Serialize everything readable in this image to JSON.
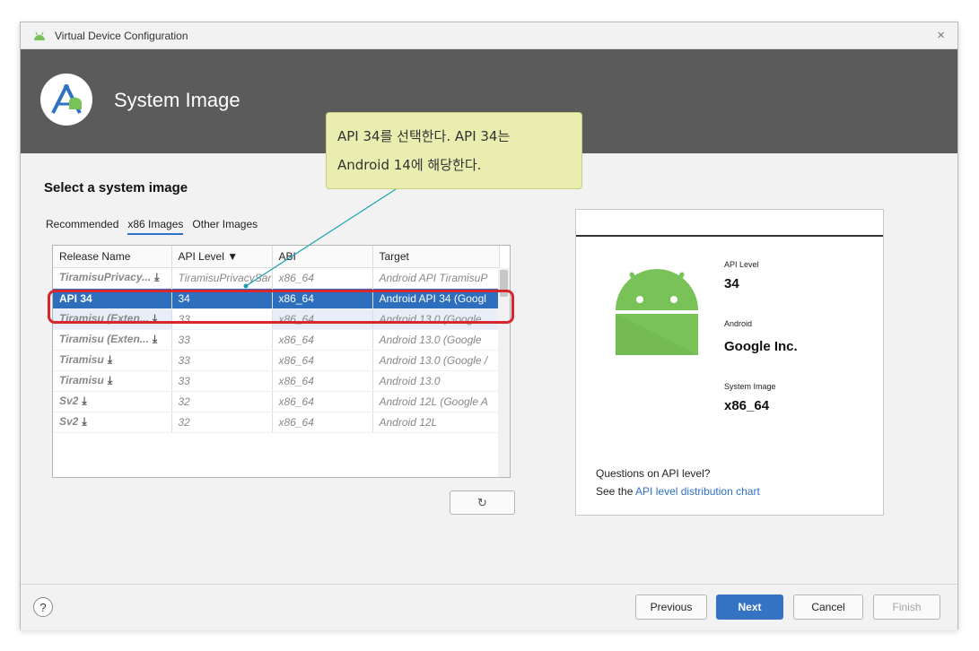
{
  "window": {
    "title": "Virtual Device Configuration",
    "close_glyph": "×"
  },
  "header": {
    "title": "System Image"
  },
  "callout": {
    "line1": "API 34를 선택한다. API 34는",
    "line2": "Android 14에 해당한다."
  },
  "section_title": "Select a system image",
  "tabs": [
    {
      "label": "Recommended"
    },
    {
      "label": "x86 Images",
      "active": true
    },
    {
      "label": "Other Images"
    }
  ],
  "table": {
    "columns": [
      "Release Name",
      "API Level ▼",
      "ABI",
      "Target"
    ],
    "rows": [
      {
        "name": "TiramisuPrivacy...",
        "download": true,
        "api": "TiramisuPrivacySar",
        "abi": "x86_64",
        "target": "Android API TiramisuP"
      },
      {
        "name": "API 34",
        "download": false,
        "api": "34",
        "abi": "x86_64",
        "target": "Android API 34 (Googl",
        "selected": true
      },
      {
        "name": "Tiramisu (Exten...",
        "download": true,
        "api": "33",
        "abi": "x86_64",
        "target": "Android 13.0 (Google ",
        "light": true
      },
      {
        "name": "Tiramisu (Exten...",
        "download": true,
        "api": "33",
        "abi": "x86_64",
        "target": "Android 13.0 (Google "
      },
      {
        "name": "Tiramisu",
        "download": true,
        "api": "33",
        "abi": "x86_64",
        "target": "Android 13.0 (Google /"
      },
      {
        "name": "Tiramisu",
        "download": true,
        "api": "33",
        "abi": "x86_64",
        "target": "Android 13.0"
      },
      {
        "name": "Sv2",
        "download": true,
        "api": "32",
        "abi": "x86_64",
        "target": "Android 12L (Google A"
      },
      {
        "name": "Sv2",
        "download": true,
        "api": "32",
        "abi": "x86_64",
        "target": "Android 12L"
      }
    ]
  },
  "refresh_glyph": "↻",
  "details": {
    "api_level_label": "API Level",
    "api_level_value": "34",
    "vendor_label": "Android",
    "vendor_value": "Google Inc.",
    "system_image_label": "System Image",
    "system_image_value": "x86_64",
    "questions": "Questions on API level?",
    "see_the": "See the ",
    "link": "API level distribution chart"
  },
  "footer": {
    "help": "?",
    "previous": "Previous",
    "next": "Next",
    "cancel": "Cancel",
    "finish": "Finish"
  },
  "colors": {
    "accent": "#3574c4",
    "selection": "#2e6fbd",
    "header_bg": "#5b5b5b",
    "highlight": "#d9262d",
    "callout_bg": "#e9eeb0",
    "android_green": "#78c257"
  }
}
